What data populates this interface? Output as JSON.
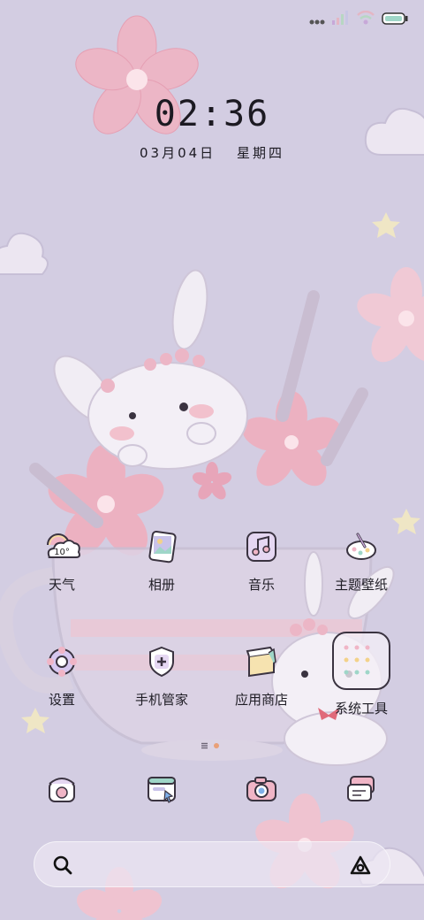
{
  "clock": {
    "time": "02:36",
    "date": "03月04日",
    "weekday": "星期四"
  },
  "status_bar": {
    "icons": [
      "more-dots-icon",
      "signal-icon",
      "wifi-icon",
      "battery-icon"
    ]
  },
  "apps": [
    {
      "label": "天气",
      "icon": "weather-icon",
      "badge": "10°"
    },
    {
      "label": "相册",
      "icon": "gallery-icon"
    },
    {
      "label": "音乐",
      "icon": "music-icon"
    },
    {
      "label": "主题壁纸",
      "icon": "theme-icon"
    },
    {
      "label": "设置",
      "icon": "settings-icon"
    },
    {
      "label": "手机管家",
      "icon": "security-icon"
    },
    {
      "label": "应用商店",
      "icon": "app-store-icon"
    },
    {
      "label": "系统工具",
      "icon": "folder-icon"
    }
  ],
  "page_indicator": {
    "current_page": 2,
    "pages": 2
  },
  "dock": [
    {
      "icon": "phone-icon"
    },
    {
      "icon": "browser-icon"
    },
    {
      "icon": "camera-icon"
    },
    {
      "icon": "messages-icon"
    }
  ],
  "search": {
    "icon": "search-icon",
    "assistant_icon": "assistant-icon"
  },
  "colors": {
    "background": "#d3cde2",
    "petal": "#eab3c3",
    "petal_light": "#f3d4de",
    "text": "#1c1a22"
  }
}
